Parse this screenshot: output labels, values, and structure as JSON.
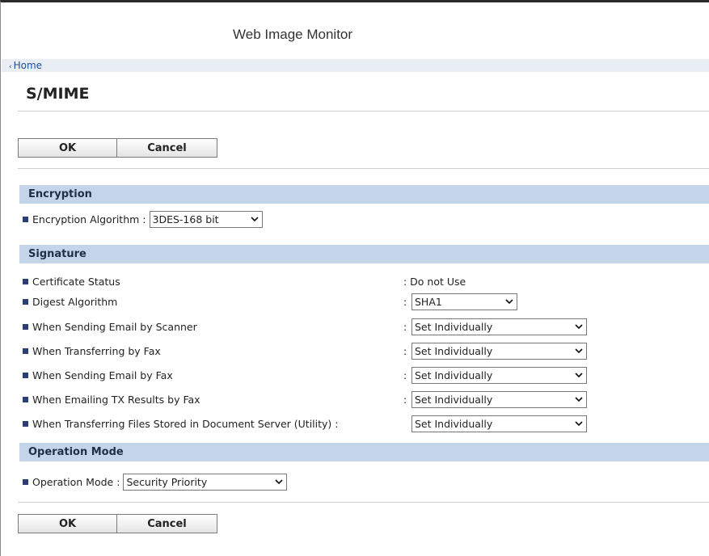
{
  "app": {
    "title": "Web Image Monitor"
  },
  "breadcrumb": {
    "home": "Home"
  },
  "page": {
    "title": "S/MIME"
  },
  "buttons": {
    "ok": "OK",
    "cancel": "Cancel"
  },
  "encryption": {
    "heading": "Encryption",
    "algorithm_label": "Encryption Algorithm :",
    "algorithm_value": "3DES-168 bit"
  },
  "signature": {
    "heading": "Signature",
    "rows": [
      {
        "label": "Certificate Status",
        "value": ": Do not Use"
      },
      {
        "label": "Digest Algorithm",
        "colon": ":",
        "value": "SHA1"
      },
      {
        "label": "When Sending Email by Scanner",
        "colon": ":",
        "value": "Set Individually"
      },
      {
        "label": "When Transferring by Fax",
        "colon": ":",
        "value": "Set Individually"
      },
      {
        "label": "When Sending Email by Fax",
        "colon": ":",
        "value": "Set Individually"
      },
      {
        "label": "When Emailing TX Results by Fax",
        "colon": ":",
        "value": "Set Individually"
      },
      {
        "label": "When Transferring Files Stored in Document Server (Utility) :",
        "value": "Set Individually"
      }
    ]
  },
  "operation_mode": {
    "heading": "Operation Mode",
    "label": "Operation Mode :",
    "value": "Security Priority"
  },
  "colors": {
    "section_header": "#c5d5e9",
    "bullet": "#2b3f75",
    "link": "#1a4f9c"
  }
}
